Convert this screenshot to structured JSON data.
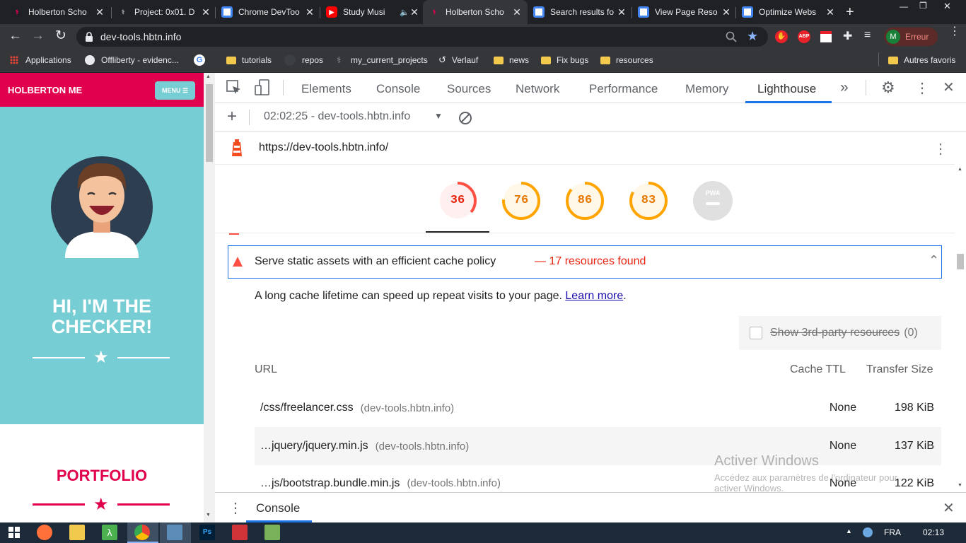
{
  "tabs": [
    {
      "title": "Holberton Scho",
      "color": "#e0004d"
    },
    {
      "title": "Project: 0x01. D",
      "color": "#202124"
    },
    {
      "title": "Chrome DevToo",
      "color": "#4285f4"
    },
    {
      "title": "Study Musi",
      "color": "#ff0000"
    },
    {
      "title": "Holberton Scho",
      "color": "#e0004d"
    },
    {
      "title": "Search results fo",
      "color": "#4285f4"
    },
    {
      "title": "View Page Reso",
      "color": "#4285f4"
    },
    {
      "title": "Optimize Webs",
      "color": "#4285f4"
    }
  ],
  "window_controls": {
    "minimize": "—",
    "restore": "❐",
    "close": "✕"
  },
  "address": {
    "url": "dev-tools.hbtn.info",
    "profile_initial": "M",
    "profile_label": "Erreur",
    "abp": "ABP"
  },
  "bookmarks": [
    {
      "label": "Applications",
      "icon": "apps-grid-icon"
    },
    {
      "label": "Offliberty - evidenc...",
      "icon": "power-icon"
    },
    {
      "label": "",
      "icon": "google-icon"
    },
    {
      "label": "tutorials",
      "icon": "folder-icon"
    },
    {
      "label": "repos",
      "icon": "github-icon"
    },
    {
      "label": "my_current_projects",
      "icon": "holberton-icon"
    },
    {
      "label": "Verlauf",
      "icon": "history-icon"
    },
    {
      "label": "news",
      "icon": "folder-icon"
    },
    {
      "label": "Fix bugs",
      "icon": "folder-icon"
    },
    {
      "label": "resources",
      "icon": "folder-icon"
    }
  ],
  "bookmarks_other": "Autres favoris",
  "site": {
    "brand": "HOLBERTON ME",
    "menu_label": "MENU ☰",
    "hero_line1": "HI, I'M THE",
    "hero_line2": "CHECKER!",
    "portfolio": "PORTFOLIO",
    "colors": {
      "brand": "#e0004d",
      "hero_bg": "#76cdd4"
    }
  },
  "devtools": {
    "tabs": [
      "Elements",
      "Console",
      "Sources",
      "Network",
      "Performance",
      "Memory",
      "Lighthouse"
    ],
    "active_tab": "Lighthouse",
    "more_tabs": "»",
    "report_select": "02:02:25 - dev-tools.hbtn.info",
    "report_url": "https://dev-tools.hbtn.info/",
    "scores": [
      {
        "value": 36,
        "fraction": 0.36,
        "color": "#ff4e42",
        "bg": "#fff0f0"
      },
      {
        "value": 76,
        "fraction": 0.76,
        "color": "#ffa400",
        "bg": "#fff8e8"
      },
      {
        "value": 86,
        "fraction": 0.86,
        "color": "#ffa400",
        "bg": "#fff8e8"
      },
      {
        "value": 83,
        "fraction": 0.83,
        "color": "#ffa400",
        "bg": "#fff8e8"
      }
    ],
    "pwa_label": "PWA",
    "audit": {
      "title": "Serve static assets with an efficient cache policy",
      "result": "— 17 resources found",
      "description": "A long cache lifetime can speed up repeat visits to your page.",
      "learn_more": "Learn more",
      "period": ".",
      "third_party": "Show 3rd-party resources",
      "third_party_count": "(0)",
      "columns": {
        "url": "URL",
        "ttl": "Cache TTL",
        "size": "Transfer Size"
      },
      "rows": [
        {
          "url": "/css/freelancer.css",
          "domain": "(dev-tools.hbtn.info)",
          "ttl": "None",
          "size": "198 KiB"
        },
        {
          "url": "…jquery/jquery.min.js",
          "domain": "(dev-tools.hbtn.info)",
          "ttl": "None",
          "size": "137 KiB"
        },
        {
          "url": "…js/bootstrap.bundle.min.js",
          "domain": "(dev-tools.hbtn.info)",
          "ttl": "None",
          "size": "122 KiB"
        }
      ]
    },
    "drawer_tab": "Console"
  },
  "watermark": {
    "title": "Activer Windows",
    "line1": "Accédez aux paramètres de l'ordinateur pour",
    "line2": "activer Windows."
  },
  "taskbar": {
    "lang": "FRA",
    "time": "02:13"
  }
}
